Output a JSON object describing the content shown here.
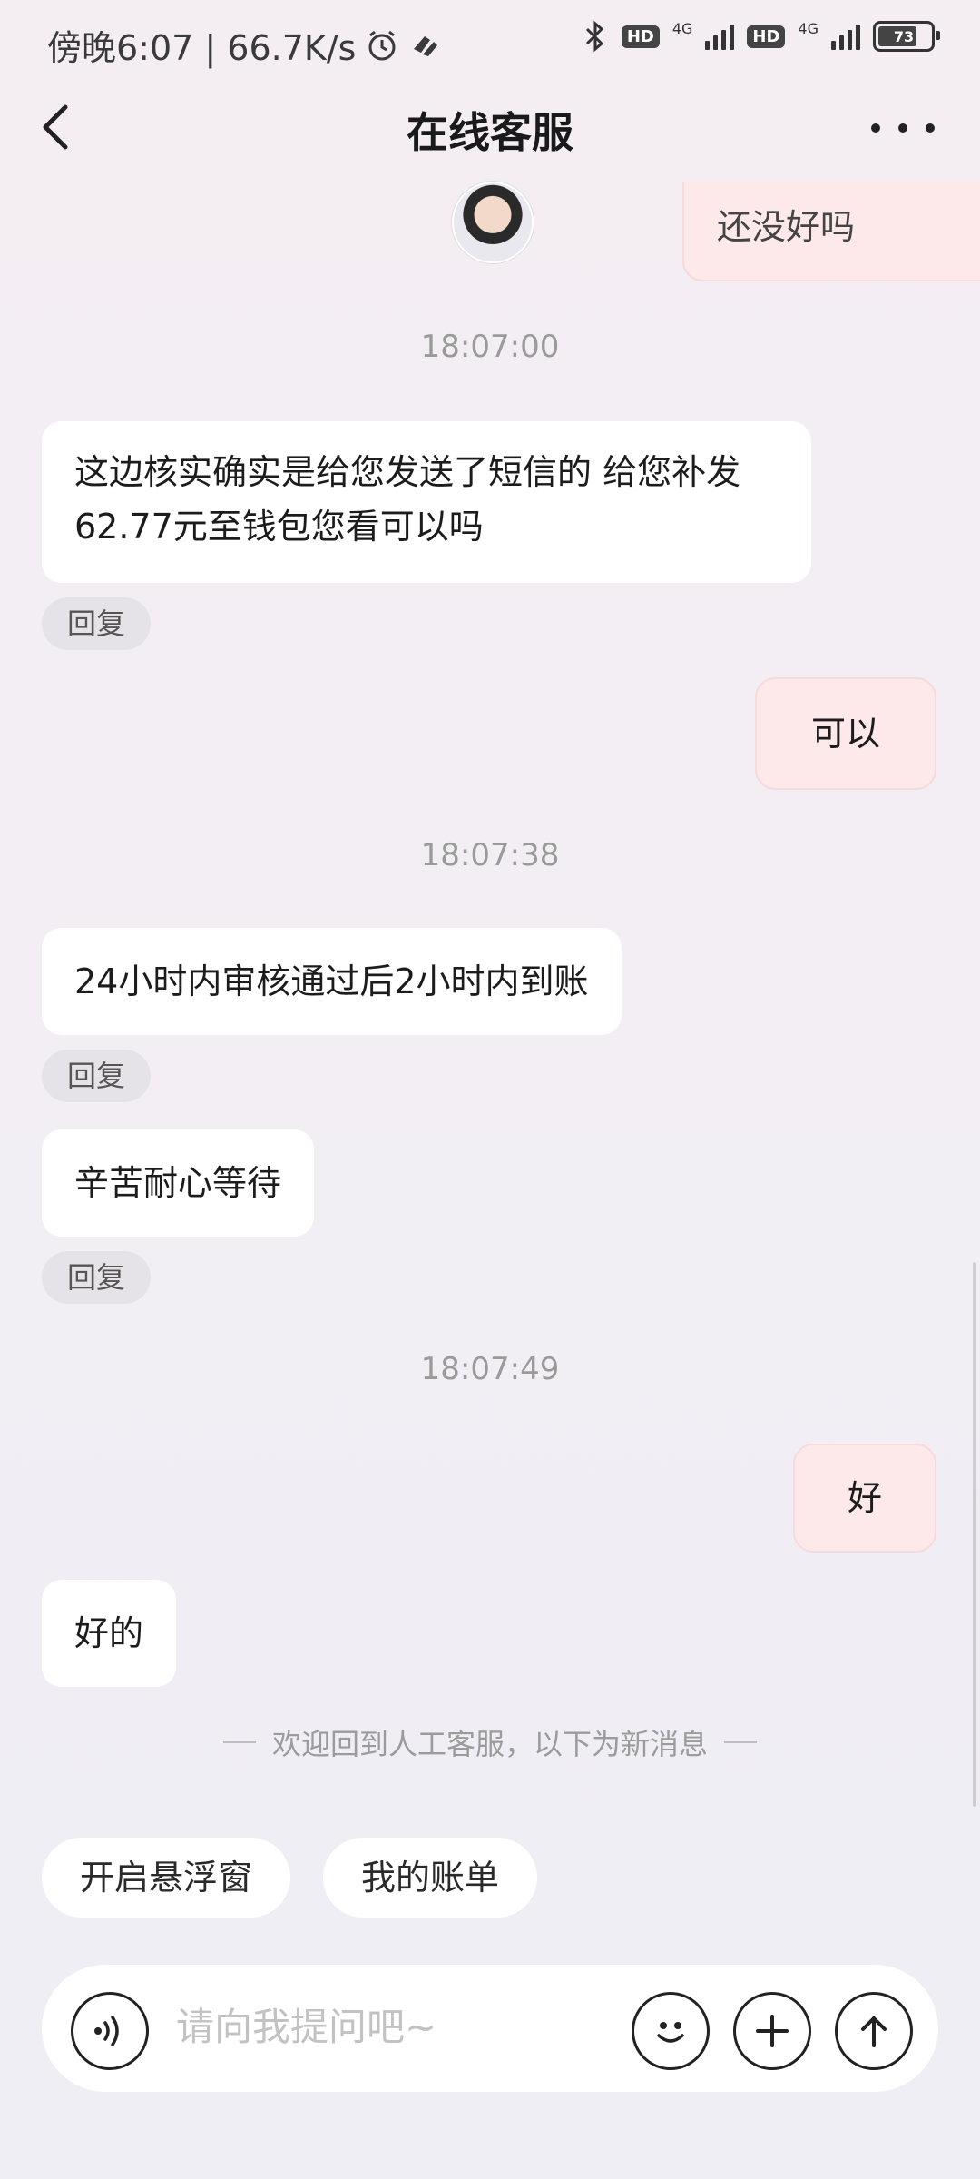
{
  "status_bar": {
    "time_speed": "傍晚6:07 | 66.7K/s",
    "hd1": "HD",
    "net1": "4G",
    "hd2": "HD",
    "net2": "4G",
    "battery": "73"
  },
  "header": {
    "title": "在线客服"
  },
  "messages": {
    "partial_top": "还没好吗",
    "ts1": "18:07:00",
    "agent1": "这边核实确实是给您发送了短信的 给您补发62.77元至钱包您看可以吗",
    "reply1": "回复",
    "me1": "可以",
    "ts2": "18:07:38",
    "agent2": "24小时内审核通过后2小时内到账",
    "reply2": "回复",
    "agent3": "辛苦耐心等待",
    "reply3": "回复",
    "ts3": "18:07:49",
    "me2": "好",
    "agent4": "好的"
  },
  "notice": "欢迎回到人工客服，以下为新消息",
  "quick_actions": [
    "开启悬浮窗",
    "我的账单"
  ],
  "input": {
    "placeholder": "请向我提问吧~"
  }
}
